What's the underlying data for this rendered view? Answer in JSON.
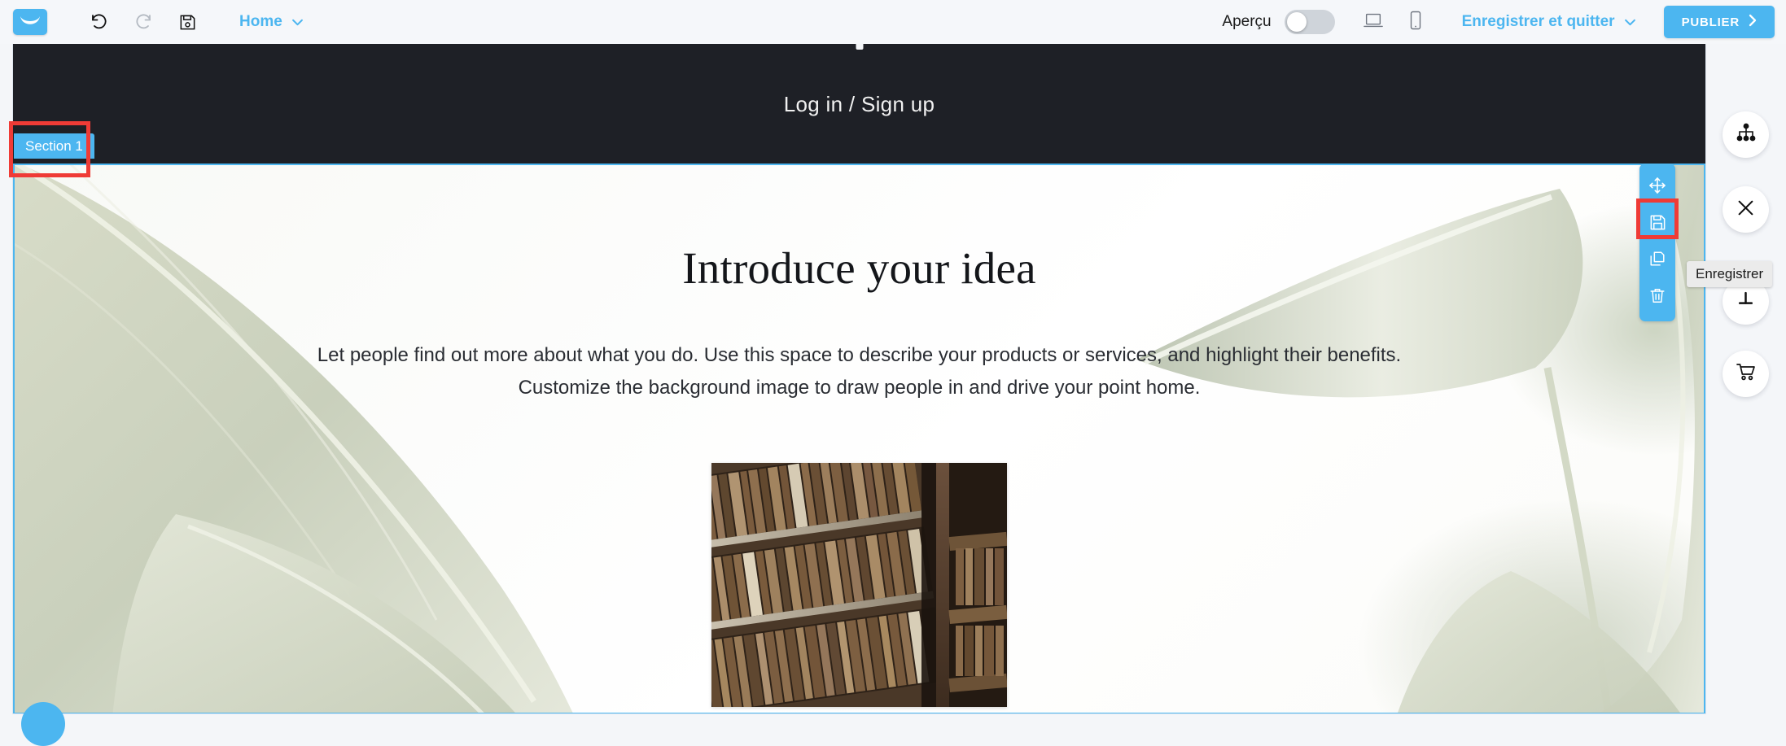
{
  "app": {
    "logo_icon": "getresponse-smile-logo",
    "accent_color": "#4cb6f0",
    "annotation_color": "#ef3b36"
  },
  "toolbar": {
    "undo_icon": "undo-arrow-icon",
    "redo_icon": "redo-arrow-icon",
    "save_icon": "floppy-disk-save-icon",
    "page_name": "Home",
    "page_chevron_icon": "chevron-down-icon",
    "preview_label": "Aperçu",
    "preview_toggle_state": "off",
    "desktop_icon": "laptop-icon",
    "mobile_icon": "smartphone-icon",
    "save_exit_label": "Enregistrer et quitter",
    "save_exit_chevron_icon": "chevron-down-icon",
    "publish_label": "PUBLIER",
    "publish_chevron_icon": "chevron-right-icon"
  },
  "canvas": {
    "site_header": {
      "login_link": "Log in / Sign up"
    },
    "section_tag": "Section 1",
    "hero": {
      "title": "Introduce your idea",
      "body": "Let people find out more about what you do. Use this space to describe your products or services, and highlight their benefits. Customize the background image to draw people in and drive your point home.",
      "photo_alt": "library-bookshelf-photo"
    }
  },
  "section_actions": {
    "move_icon": "move-arrows-icon",
    "save_icon": "floppy-disk-save-icon",
    "duplicate_icon": "duplicate-copy-icon",
    "delete_icon": "trash-bin-icon"
  },
  "right_rail": {
    "sitemap_icon": "sitemap-hierarchy-icon",
    "close_icon": "close-x-icon",
    "anchor_icon": "anchor-pin-icon",
    "cart_icon": "shopping-cart-icon",
    "fab_icon": "help-chat-bubble-icon"
  },
  "tooltip": {
    "text": "Enregistrer"
  }
}
